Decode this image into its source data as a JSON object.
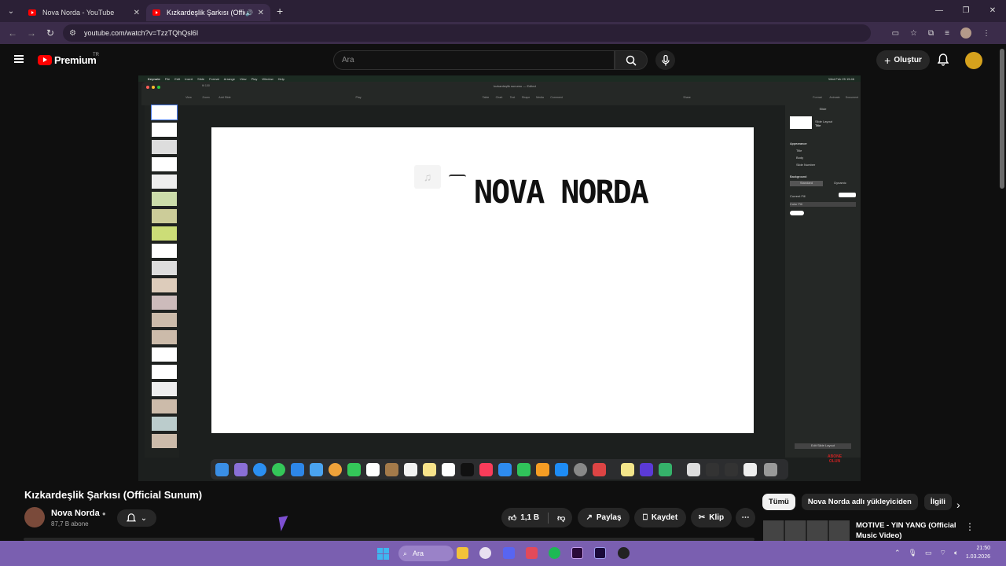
{
  "browser": {
    "tabs": [
      {
        "title": "Nova Norda - YouTube",
        "active": false
      },
      {
        "title": "Kızkardeşlik Şarkısı (Official",
        "active": true
      }
    ],
    "url": "youtube.com/watch?v=TzzTQhQsl6I"
  },
  "youtube": {
    "logo_text": "Premium",
    "country": "TR",
    "search_placeholder": "Ara",
    "create_label": "Oluştur"
  },
  "video_frame": {
    "app_menu": [
      "Keynote",
      "File",
      "Edit",
      "Insert",
      "Slide",
      "Format",
      "Arrange",
      "View",
      "Play",
      "Window",
      "Help"
    ],
    "clock": "Wed Feb 25  15:46",
    "doc_title": "kızkardeşlik sunumu — Edited",
    "toolbar": [
      "View",
      "Zoom",
      "Add Slide",
      "Play",
      "Table",
      "Chart",
      "Text",
      "Shape",
      "Media",
      "Comment",
      "Share",
      "Format",
      "Animate",
      "Document"
    ],
    "zoom_value": "fit 100",
    "slide_headline": "NOVA NORDA",
    "inspector": {
      "header": "Slide",
      "layout_label": "Slide Layout",
      "layout_value": "Title",
      "appearance_label": "Appearance",
      "appearance_items": [
        "Title",
        "Body",
        "Slide Number"
      ],
      "background_label": "Background",
      "seg_standard": "Standard",
      "seg_dynamic": "Dynamic",
      "current_fill": "Current Fill",
      "color_fill": "Color Fill",
      "edit_layout": "Edit Slide Layout"
    },
    "watermark": "ABONE OLUN"
  },
  "video_info": {
    "title": "Kızkardeşlik Şarkısı (Official Sunum)",
    "channel": "Nova Norda",
    "subscribers": "87,7 B abone",
    "likes": "1,1 B",
    "share_label": "Paylaş",
    "save_label": "Kaydet",
    "clip_label": "Klip"
  },
  "chips": [
    "Tümü",
    "Nova Norda adlı yükleyiciden",
    "İlgili"
  ],
  "recommendation": {
    "title": "MOTIVE - YIN YANG (Official Music Video)"
  },
  "taskbar": {
    "search_label": "Ara",
    "time": "21:50",
    "date": "1.03.2026"
  },
  "colors": {
    "yt_red": "#ff0000",
    "taskbar": "#7a5fb0",
    "chrome": "#3b2c4a"
  }
}
